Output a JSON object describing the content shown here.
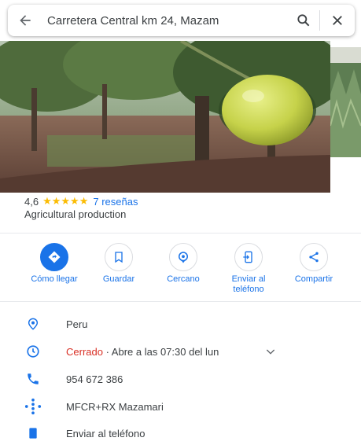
{
  "search": {
    "query": "Carretera Central km 24, Mazam"
  },
  "place": {
    "rating": "4,6",
    "stars": "★★★★★",
    "reviews": "7 reseñas",
    "category": "Agricultural production"
  },
  "actions": [
    {
      "label": "Cómo llegar"
    },
    {
      "label": "Guardar"
    },
    {
      "label": "Cercano"
    },
    {
      "label": "Enviar al teléfono"
    },
    {
      "label": "Compartir"
    }
  ],
  "details": {
    "country": "Peru",
    "hours_status": "Cerrado",
    "hours_rest": " · Abre a las 07:30 del lun",
    "phone": "954 672 386",
    "pluscode": "MFCR+RX Mazamari",
    "extra": "Enviar al teléfono"
  },
  "colors": {
    "accent": "#1a73e8",
    "closed": "#d93025",
    "star": "#fbbc04"
  }
}
